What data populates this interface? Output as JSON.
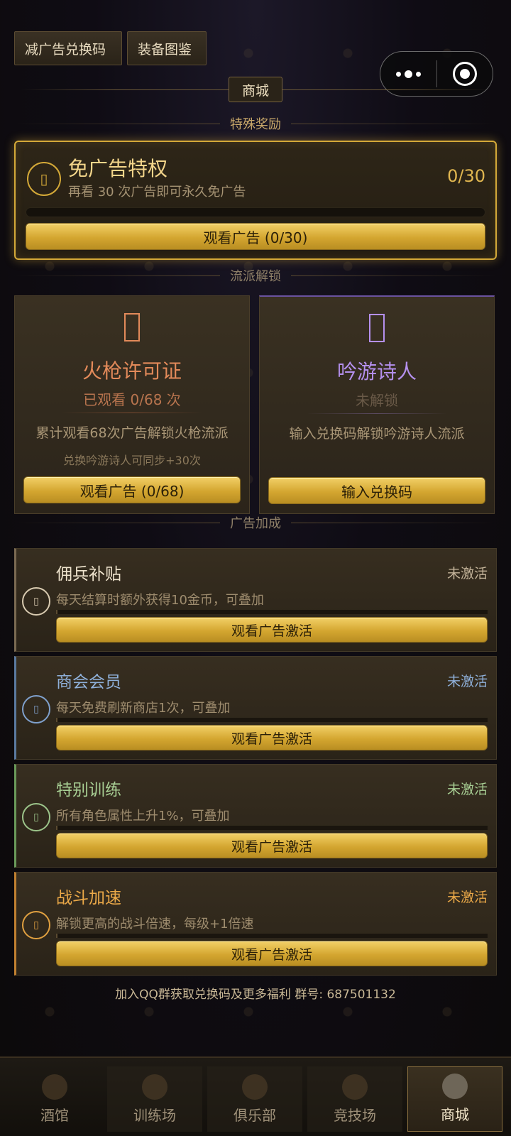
{
  "top_buttons": {
    "code_label": "减广告兑换码",
    "equip_label": "装备图鉴"
  },
  "shop_title": "商城",
  "special": {
    "header": "特殊奖励",
    "title": "免广告特权",
    "desc": "再看 30 次广告即可永久免广告",
    "count": "0/30",
    "progress": 0,
    "button": "观看广告 (0/30)"
  },
  "classes": {
    "header": "流派解锁",
    "gun": {
      "name": "火枪许可证",
      "status": "已观看 0/68 次",
      "info": "累计观看68次广告解锁火枪流派",
      "info2": "兑换吟游诗人可同步+30次",
      "button": "观看广告 (0/68)"
    },
    "bard": {
      "name": "吟游诗人",
      "status": "未解锁",
      "info": "输入兑换码解锁吟游诗人流派",
      "button": "输入兑换码"
    }
  },
  "bonuses": {
    "header": "广告加成",
    "items": [
      {
        "title": "佣兵补贴",
        "state": "未激活",
        "desc": "每天结算时额外获得10金币，可叠加",
        "button": "观看广告激活"
      },
      {
        "title": "商会会员",
        "state": "未激活",
        "desc": "每天免费刷新商店1次，可叠加",
        "button": "观看广告激活"
      },
      {
        "title": "特别训练",
        "state": "未激活",
        "desc": "所有角色属性上升1%，可叠加",
        "button": "观看广告激活"
      },
      {
        "title": "战斗加速",
        "state": "未激活",
        "desc": "解锁更高的战斗倍速，每级+1倍速",
        "button": "观看广告激活"
      }
    ]
  },
  "qq_text": "加入QQ群获取兑换码及更多福利  群号: 687501132",
  "tabs": [
    {
      "label": "酒馆"
    },
    {
      "label": "训练场"
    },
    {
      "label": "俱乐部"
    },
    {
      "label": "竞技场"
    },
    {
      "label": "商城"
    }
  ]
}
